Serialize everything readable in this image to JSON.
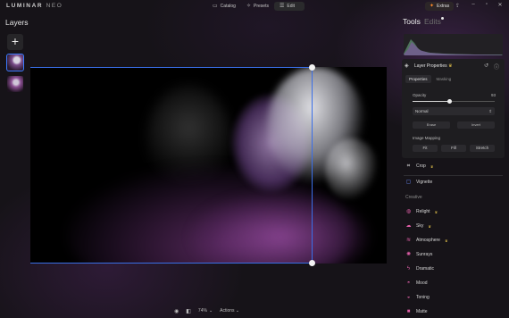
{
  "topbar": {
    "logo_main": "LUMINAR",
    "logo_sub": "NEO",
    "nav": [
      {
        "label": "Catalog",
        "icon": "folder-icon"
      },
      {
        "label": "Presets",
        "icon": "presets-icon"
      },
      {
        "label": "Edit",
        "icon": "sliders-icon",
        "active": true
      }
    ],
    "extras_label": "Extras"
  },
  "layers": {
    "title": "Layers",
    "add_symbol": "+"
  },
  "canvas": {
    "zoom": "74%",
    "actions_label": "Actions"
  },
  "tools_panel": {
    "tools_tab": "Tools",
    "edits_tab": "Edits",
    "layer_properties": {
      "title": "Layer Properties",
      "subtabs": [
        "Properties",
        "Masking"
      ],
      "opacity_label": "Opacity",
      "opacity_value": "93",
      "opacity_fraction": 0.45,
      "blend_mode": "Normal",
      "mask_btn_1": "Erase",
      "mask_btn_2": "Invert",
      "image_mapping_label": "Image Mapping",
      "mapping_options": [
        "Fit",
        "Fill",
        "Stretch"
      ]
    },
    "tools": [
      {
        "label": "Crop",
        "icon": "crop-icon",
        "pro": true
      },
      {
        "label": "Vignette",
        "icon": "vignette-icon",
        "pro": false
      }
    ],
    "creative_label": "Creative",
    "creative_tools": [
      {
        "label": "Relight",
        "icon": "relight-icon",
        "pro": true
      },
      {
        "label": "Sky",
        "icon": "cloud-icon",
        "pro": true
      },
      {
        "label": "Atmosphere",
        "icon": "atmosphere-icon",
        "pro": true
      },
      {
        "label": "Sunrays",
        "icon": "sun-icon",
        "pro": false
      },
      {
        "label": "Dramatic",
        "icon": "lightning-icon",
        "pro": false
      },
      {
        "label": "Mood",
        "icon": "mood-icon",
        "pro": false
      },
      {
        "label": "Toning",
        "icon": "toning-icon",
        "pro": false
      },
      {
        "label": "Matte",
        "icon": "matte-icon",
        "pro": false
      }
    ]
  },
  "colors": {
    "accent": "#3a6fe8",
    "extras_star": "#ff8a2a",
    "crown": "#e3c24b"
  }
}
